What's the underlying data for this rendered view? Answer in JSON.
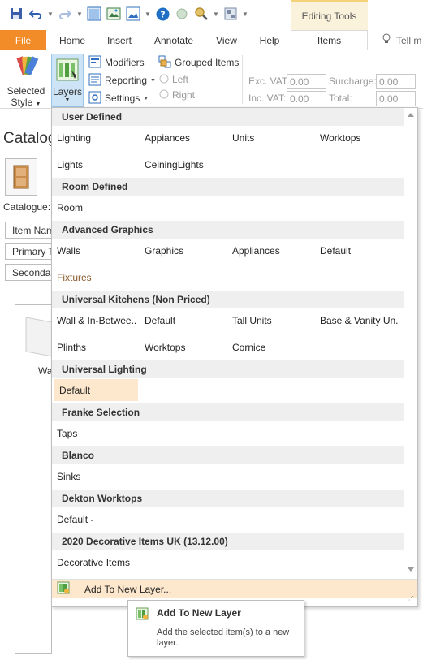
{
  "contextual_header": "Editing Tools",
  "tabs": [
    {
      "label": "File"
    },
    {
      "label": "Home"
    },
    {
      "label": "Insert"
    },
    {
      "label": "Annotate"
    },
    {
      "label": "View"
    },
    {
      "label": "Help"
    },
    {
      "label": "Items"
    }
  ],
  "tell_me": "Tell m",
  "ribbon": {
    "selected_style": "Selected",
    "selected_style_2": "Style",
    "layers": "Layers",
    "modifiers": "Modifiers",
    "reporting": "Reporting",
    "settings": "Settings",
    "grouped_items": "Grouped Items",
    "left": "Left",
    "right": "Right",
    "exc_vat_label": "Exc. VAT:",
    "exc_vat_value": "0.00",
    "inc_vat_label": "Inc. VAT:",
    "inc_vat_value": "0.00",
    "surcharge_label": "Surcharge:",
    "surcharge_value": "0.00",
    "total_label": "Total:",
    "total_value": "0.00"
  },
  "background": {
    "catalogue_title": "Catalog",
    "catalogue_label": "Catalogue:",
    "item_name": "Item Name",
    "primary_type": "Primary Typ",
    "secondary_type": "Secondary T",
    "wall_label": "Wa"
  },
  "layers_dropdown": {
    "groups": [
      {
        "title": "User Defined",
        "items": [
          "Lighting",
          "Appiances",
          "Units",
          "Worktops",
          "Lights",
          "CeiningLights"
        ]
      },
      {
        "title": "Room Defined",
        "items": [
          "Room"
        ]
      },
      {
        "title": "Advanced Graphics",
        "items": [
          "Walls",
          "Graphics",
          "Appliances",
          "Default",
          "Fixtures"
        ]
      },
      {
        "title": "Universal Kitchens (Non Priced)",
        "items": [
          "Wall & In-Betwee...",
          "Default",
          "Tall Units",
          "Base & Vanity Un...",
          "Plinths",
          "Worktops",
          "Cornice"
        ]
      },
      {
        "title": "Universal Lighting",
        "items": [
          "Default"
        ]
      },
      {
        "title": "Franke Selection",
        "items": [
          "Taps"
        ]
      },
      {
        "title": "Blanco",
        "items": [
          "Sinks"
        ]
      },
      {
        "title": "Dekton Worktops",
        "items": [
          "Default -"
        ]
      },
      {
        "title": "2020 Decorative Items UK (13.12.00)",
        "items": [
          "Decorative Items"
        ]
      }
    ],
    "footer_action": "Add To New Layer..."
  },
  "tooltip": {
    "title": "Add To New Layer",
    "body": "Add the selected item(s) to a new layer."
  },
  "colors": {
    "file_tab": "#f28c28",
    "highlight": "#fde7cd",
    "group_header": "#efefef"
  }
}
